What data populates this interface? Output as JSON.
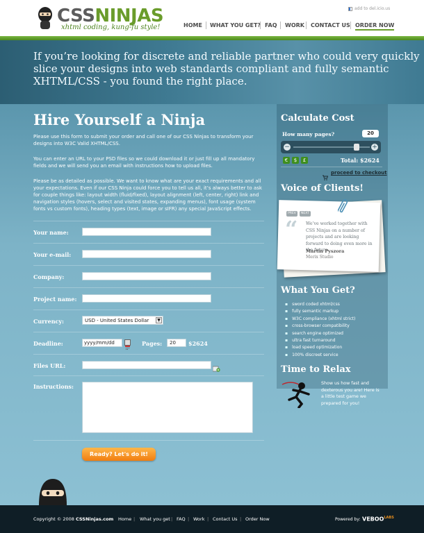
{
  "header": {
    "logo": "CSSNINJAS",
    "logo_css": "CSS",
    "logo_ninjas": "NINJAS",
    "tagline": "xhtml coding, kung-fu style!",
    "delicious": "add to del.icio.us",
    "nav": [
      "HOME",
      "WHAT YOU GET?",
      "FAQ",
      "WORK",
      "CONTACT US",
      "ORDER NOW"
    ]
  },
  "hero": {
    "text": "If you’re looking for discrete and reliable partner who could very quickly slice your designs into web standards compliant and fully semantic XHTML/CSS - you found the right place."
  },
  "order": {
    "title": "Hire Yourself a Ninja",
    "p1": "Please use this form to submit your order and call one of our CSS Ninjas to transform your designs into W3C Valid XHTML/CSS.",
    "p2": "You can enter an URL to your PSD files so we could download it or just fill up all mandatory fields and we will send you an email with instructions how to upload files.",
    "p3": "Please be as detailed as possible. We want to know what are your exact requirements and all your expectations. Even if our CSS Ninja could force you to tell us all, it’s always better to ask for couple things like: layout width (fluid/fixed), layout alignment (left, center, right) link and navigation styles (hovers, select and visited states, expanding menus), font usage (system fonts vs custom fonts), heading types (text, image or sIFR) any special JavaScript effects.",
    "labels": {
      "name": "Your name:",
      "email": "Your e-mail:",
      "company": "Company:",
      "project": "Project name:",
      "currency": "Currency:",
      "deadline": "Deadline:",
      "pages": "Pages:",
      "files": "Files URL:",
      "instructions": "Instructions:"
    },
    "currency_value": "USD - United States Dollar",
    "deadline_placeholder": "yyyy/mm/dd",
    "pages_value": "20",
    "price": "$2624",
    "submit": "Ready? Let's do it!"
  },
  "sidebar": {
    "calc_title": "Calculate Cost",
    "pages_q": "How many pages?",
    "pages_count": "20",
    "slider_level": 0.85,
    "total": "Total: $2624",
    "checkout": "proceed to checkout",
    "voice_title": "Voice of Clients!",
    "prev": "PREV",
    "next": "NEXT",
    "quote": "We’ve worked together with CSS Ninjas on a number of projects and are looking forward to doing even more in the future.",
    "author": "Martin Pyszora",
    "company": "Merix Studio",
    "what_title": "What You Get?",
    "what_items": [
      "sword coded xhtml/css",
      "fully semantic markup",
      "W3C compliance (xhtml strict)",
      "cross-browser compatibility",
      "search engine optimized",
      "ultra fast turnaround",
      "load speed optimization",
      "100% discreet service"
    ],
    "relax_title": "Time to Relax",
    "relax_text": "Show us how fast and dexterous you are! Here is a little test game we prepared for you!"
  },
  "footer": {
    "copyright": "Copyright © 2008",
    "site": "CSSNinjas.com",
    "links": [
      "Home",
      "What you get",
      "FAQ",
      "Work",
      "Contact Us",
      "Order Now"
    ],
    "powered": "Powered by:",
    "veboo": "VEBOO",
    "labs": "LABS"
  }
}
